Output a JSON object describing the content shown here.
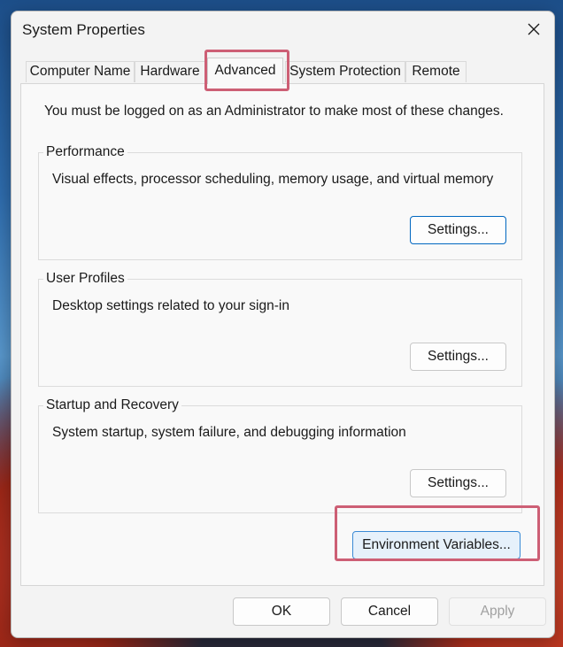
{
  "window": {
    "title": "System Properties",
    "close_icon": "close-icon"
  },
  "tabs": [
    {
      "label": "Computer Name"
    },
    {
      "label": "Hardware"
    },
    {
      "label": "Advanced",
      "active": true
    },
    {
      "label": "System Protection"
    },
    {
      "label": "Remote"
    }
  ],
  "advanced": {
    "intro": "You must be logged on as an Administrator to make most of these changes.",
    "performance": {
      "title": "Performance",
      "description": "Visual effects, processor scheduling, memory usage, and virtual memory",
      "button": "Settings..."
    },
    "user_profiles": {
      "title": "User Profiles",
      "description": "Desktop settings related to your sign-in",
      "button": "Settings..."
    },
    "startup_recovery": {
      "title": "Startup and Recovery",
      "description": "System startup, system failure, and debugging information",
      "button": "Settings..."
    },
    "env_button": "Environment Variables..."
  },
  "footer": {
    "ok": "OK",
    "cancel": "Cancel",
    "apply": "Apply"
  },
  "colors": {
    "highlight": "#cd5f75",
    "accent": "#0067c0"
  }
}
